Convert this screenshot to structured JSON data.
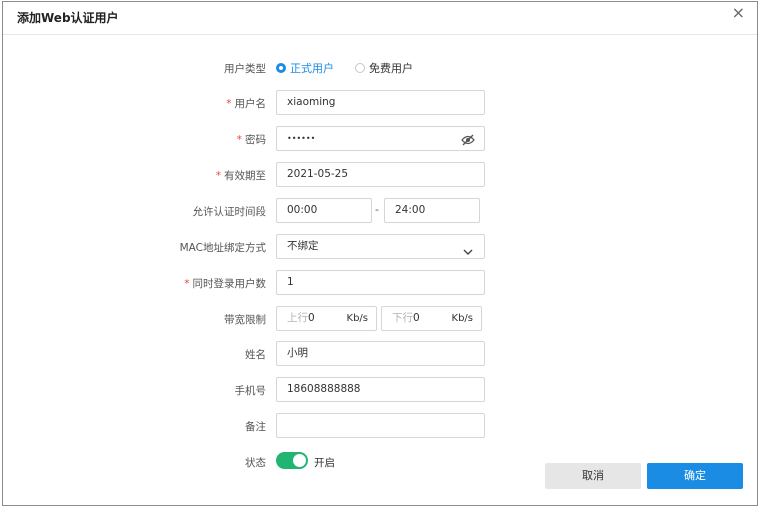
{
  "dialog": {
    "title": "添加Web认证用户",
    "close_glyph": "×"
  },
  "form": {
    "user_type": {
      "label": "用户类型",
      "options": [
        "正式用户",
        "免费用户"
      ],
      "selected": "正式用户"
    },
    "username": {
      "label": "用户名",
      "required": "*",
      "value": "xiaoming"
    },
    "password": {
      "label": "密码",
      "required": "*",
      "value": "••••••",
      "icon": "eye-slash-icon"
    },
    "valid_until": {
      "label": "有效期至",
      "required": "*",
      "value": "2021-05-25"
    },
    "auth_time": {
      "label": "允许认证时间段",
      "start": "00:00",
      "separator": "-",
      "end": "24:00"
    },
    "mac_binding": {
      "label": "MAC地址绑定方式",
      "value": "不绑定",
      "icon": "chevron-down-icon"
    },
    "concurrent_logins": {
      "label": "同时登录用户数",
      "required": "*",
      "value": "1"
    },
    "bandwidth": {
      "label": "带宽限制",
      "up_placeholder": "上行",
      "up_value": "0",
      "up_unit": "Kb/s",
      "down_placeholder": "下行",
      "down_value": "0",
      "down_unit": "Kb/s"
    },
    "name": {
      "label": "姓名",
      "value": "小明"
    },
    "phone": {
      "label": "手机号",
      "value": "18608888888"
    },
    "remark": {
      "label": "备注",
      "value": ""
    },
    "status": {
      "label": "状态",
      "value": "开启",
      "enabled": true
    }
  },
  "buttons": {
    "cancel": "取消",
    "confirm": "确定"
  },
  "colors": {
    "accent": "#1b8ce3",
    "toggle_on": "#21b573",
    "required": "#e8473c"
  }
}
